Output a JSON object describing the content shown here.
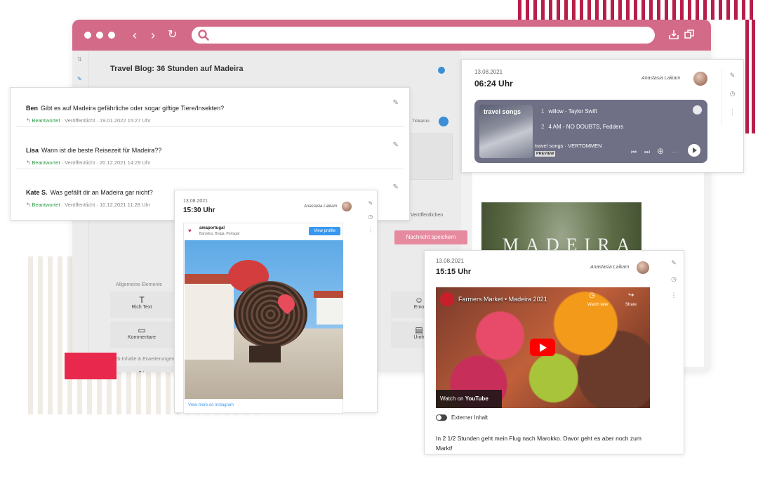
{
  "browser": {
    "icons": [
      "back-icon",
      "forward-icon",
      "reload-icon",
      "search-icon",
      "download-icon",
      "window-icon"
    ],
    "accent": "#d36a88"
  },
  "cms": {
    "title": "Travel Blog: 36 Stunden auf Madeira",
    "tickaroo": "Tickaroo",
    "publish": "Veröffentlichen",
    "save_message": "Nachricht speichern",
    "section_general": "Allgemeine Elemente",
    "section_web": "Web-Inhalte & Erweiterungen",
    "tiles": {
      "rich_text": "Rich Text",
      "comments": "Kommentare",
      "x": "X",
      "emoji": "Emo",
      "survey": "Umfr"
    }
  },
  "comments": [
    {
      "author": "Ben",
      "text": "Gibt es auf Madeira gefährliche oder sogar giftige Tiere/Insekten?",
      "status": "Beantwortet",
      "state": "Veröffentlicht",
      "date": "19.01.2022 15:27 Uhr"
    },
    {
      "author": "Lisa",
      "text": "Wann ist die beste Reisezeit für Madeira??",
      "status": "Beantwortet",
      "state": "Veröffentlicht",
      "date": "20.12.2021 14:29 Uhr"
    },
    {
      "author": "Kate S.",
      "text": "Was gefällt dir an Madeira gar nicht?",
      "status": "Beantwortet",
      "state": "Veröffentlicht",
      "date": "10.12.2021 11:28 Uhr"
    }
  ],
  "spotify_post": {
    "date": "13.08.2021",
    "time": "06:24 Uhr",
    "author": "Anastasia Laikam",
    "cover_text": "travel songs",
    "tracks": [
      {
        "num": "1",
        "title": "willow - Taylor Swift"
      },
      {
        "num": "2",
        "title": "4 AM - NO DOUBTS, Fedders"
      }
    ],
    "playlist": "travel songs · VERTOMMEN",
    "preview": "PREVIEW"
  },
  "madeira_image": {
    "text": "MADEIRA"
  },
  "insta_post": {
    "date": "13.08.2021",
    "time": "15:30 Uhr",
    "author": "Anastasia Laikam",
    "account": "amaportugal",
    "location": "Barcelos, Braga, Portugal",
    "view_profile": "View profile",
    "view_more": "View more on Instagram"
  },
  "yt_post": {
    "date": "13.08.2021",
    "time": "15:15 Uhr",
    "author": "Anastasia Laikam",
    "video_title": "Farmers Market • Madeira 2021",
    "watch_later": "Watch later",
    "share": "Share",
    "watch_on": "Watch on",
    "youtube": "YouTube",
    "external": "Externer Inhalt",
    "body": "In 2 1/2 Stunden geht mein Flug nach Marokko. Davor geht es aber noch zum Markt!"
  }
}
